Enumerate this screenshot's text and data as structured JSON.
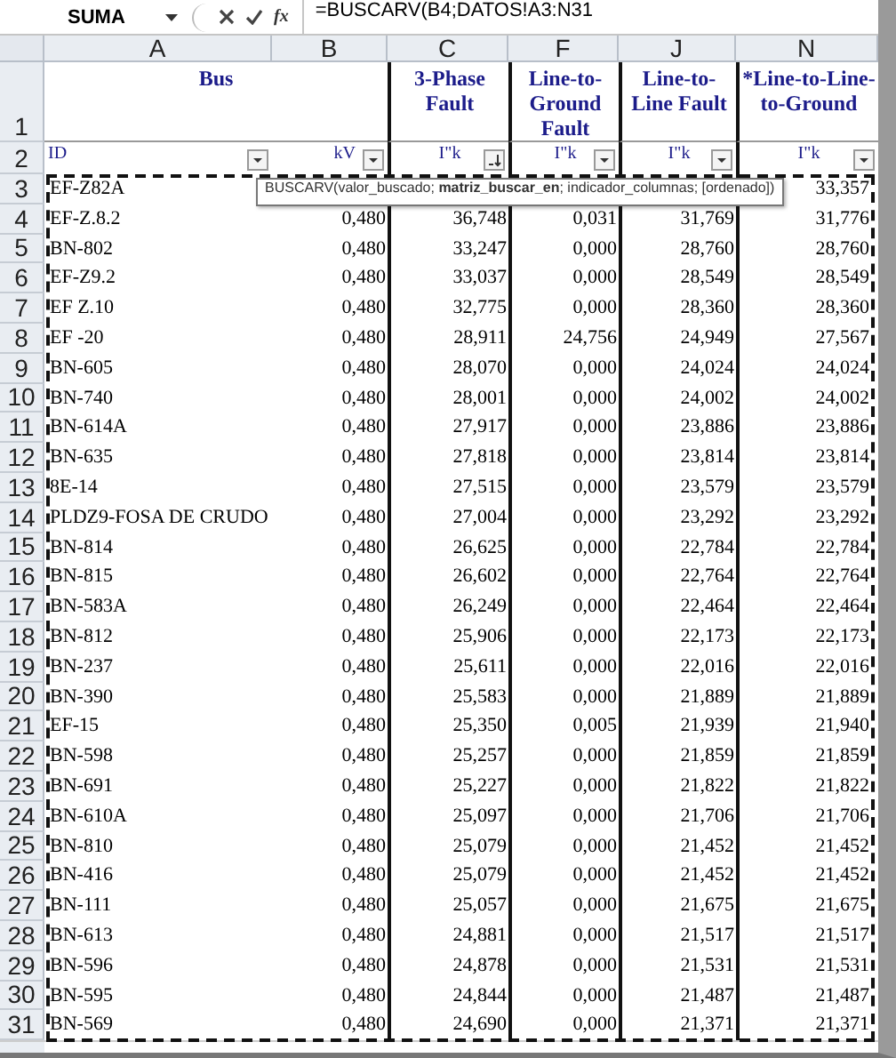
{
  "formula_bar": {
    "name_box": "SUMA",
    "function_button": "fx",
    "formula": "=BUSCARV(B4;DATOS!A3:N31"
  },
  "columns": [
    "A",
    "B",
    "C",
    "F",
    "J",
    "N"
  ],
  "header_row": {
    "num": "1",
    "bus": "Bus",
    "c": "3-Phase Fault",
    "f": "Line-to-Ground Fault",
    "j": "Line-to-Line Fault",
    "n": "*Line-to-Line-to-Ground"
  },
  "filter_row": {
    "num": "2",
    "cells": [
      {
        "label": "ID",
        "sorted": false
      },
      {
        "label": "kV",
        "sorted": false
      },
      {
        "label": "I\"k",
        "sorted": true
      },
      {
        "label": "I\"k",
        "sorted": false
      },
      {
        "label": "I\"k",
        "sorted": false
      },
      {
        "label": "I\"k",
        "sorted": false
      }
    ]
  },
  "tooltip": "BUSCARV(valor_buscado; **matriz_buscar_en**; indicador_columnas; [ordenado])",
  "rows": [
    {
      "num": "3",
      "id": "EF-Z82A",
      "n": "33,357"
    },
    {
      "num": "4",
      "id": "EF-Z.8.2",
      "kv": "0,480",
      "c": "36,748",
      "f": "0,031",
      "j": "31,769",
      "n": "31,776"
    },
    {
      "num": "5",
      "id": "BN-802",
      "kv": "0,480",
      "c": "33,247",
      "f": "0,000",
      "j": "28,760",
      "n": "28,760"
    },
    {
      "num": "6",
      "id": "EF-Z9.2",
      "kv": "0,480",
      "c": "33,037",
      "f": "0,000",
      "j": "28,549",
      "n": "28,549"
    },
    {
      "num": "7",
      "id": "EF Z.10",
      "kv": "0,480",
      "c": "32,775",
      "f": "0,000",
      "j": "28,360",
      "n": "28,360"
    },
    {
      "num": "8",
      "id": "EF -20",
      "kv": "0,480",
      "c": "28,911",
      "f": "24,756",
      "j": "24,949",
      "n": "27,567"
    },
    {
      "num": "9",
      "id": "BN-605",
      "kv": "0,480",
      "c": "28,070",
      "f": "0,000",
      "j": "24,024",
      "n": "24,024"
    },
    {
      "num": "10",
      "id": "BN-740",
      "kv": "0,480",
      "c": "28,001",
      "f": "0,000",
      "j": "24,002",
      "n": "24,002"
    },
    {
      "num": "11",
      "id": "BN-614A",
      "kv": "0,480",
      "c": "27,917",
      "f": "0,000",
      "j": "23,886",
      "n": "23,886"
    },
    {
      "num": "12",
      "id": "BN-635",
      "kv": "0,480",
      "c": "27,818",
      "f": "0,000",
      "j": "23,814",
      "n": "23,814"
    },
    {
      "num": "13",
      "id": "8E-14",
      "kv": "0,480",
      "c": "27,515",
      "f": "0,000",
      "j": "23,579",
      "n": "23,579"
    },
    {
      "num": "14",
      "id": "PLDZ9-FOSA DE CRUDO",
      "kv": "0,480",
      "c": "27,004",
      "f": "0,000",
      "j": "23,292",
      "n": "23,292"
    },
    {
      "num": "15",
      "id": "BN-814",
      "kv": "0,480",
      "c": "26,625",
      "f": "0,000",
      "j": "22,784",
      "n": "22,784"
    },
    {
      "num": "16",
      "id": "BN-815",
      "kv": "0,480",
      "c": "26,602",
      "f": "0,000",
      "j": "22,764",
      "n": "22,764"
    },
    {
      "num": "17",
      "id": "BN-583A",
      "kv": "0,480",
      "c": "26,249",
      "f": "0,000",
      "j": "22,464",
      "n": "22,464"
    },
    {
      "num": "18",
      "id": "BN-812",
      "kv": "0,480",
      "c": "25,906",
      "f": "0,000",
      "j": "22,173",
      "n": "22,173"
    },
    {
      "num": "19",
      "id": "BN-237",
      "kv": "0,480",
      "c": "25,611",
      "f": "0,000",
      "j": "22,016",
      "n": "22,016"
    },
    {
      "num": "20",
      "id": "BN-390",
      "kv": "0,480",
      "c": "25,583",
      "f": "0,000",
      "j": "21,889",
      "n": "21,889"
    },
    {
      "num": "21",
      "id": "EF-15",
      "kv": "0,480",
      "c": "25,350",
      "f": "0,005",
      "j": "21,939",
      "n": "21,940"
    },
    {
      "num": "22",
      "id": "BN-598",
      "kv": "0,480",
      "c": "25,257",
      "f": "0,000",
      "j": "21,859",
      "n": "21,859"
    },
    {
      "num": "23",
      "id": "BN-691",
      "kv": "0,480",
      "c": "25,227",
      "f": "0,000",
      "j": "21,822",
      "n": "21,822"
    },
    {
      "num": "24",
      "id": "BN-610A",
      "kv": "0,480",
      "c": "25,097",
      "f": "0,000",
      "j": "21,706",
      "n": "21,706"
    },
    {
      "num": "25",
      "id": "BN-810",
      "kv": "0,480",
      "c": "25,079",
      "f": "0,000",
      "j": "21,452",
      "n": "21,452"
    },
    {
      "num": "26",
      "id": "BN-416",
      "kv": "0,480",
      "c": "25,079",
      "f": "0,000",
      "j": "21,452",
      "n": "21,452"
    },
    {
      "num": "27",
      "id": "BN-111",
      "kv": "0,480",
      "c": "25,057",
      "f": "0,000",
      "j": "21,675",
      "n": "21,675"
    },
    {
      "num": "28",
      "id": "BN-613",
      "kv": "0,480",
      "c": "24,881",
      "f": "0,000",
      "j": "21,517",
      "n": "21,517"
    },
    {
      "num": "29",
      "id": "BN-596",
      "kv": "0,480",
      "c": "24,878",
      "f": "0,000",
      "j": "21,531",
      "n": "21,531"
    },
    {
      "num": "30",
      "id": "BN-595",
      "kv": "0,480",
      "c": "24,844",
      "f": "0,000",
      "j": "21,487",
      "n": "21,487"
    },
    {
      "num": "31",
      "id": "BN-569",
      "kv": "0,480",
      "c": "24,690",
      "f": "0,000",
      "j": "21,371",
      "n": "21,371"
    }
  ]
}
